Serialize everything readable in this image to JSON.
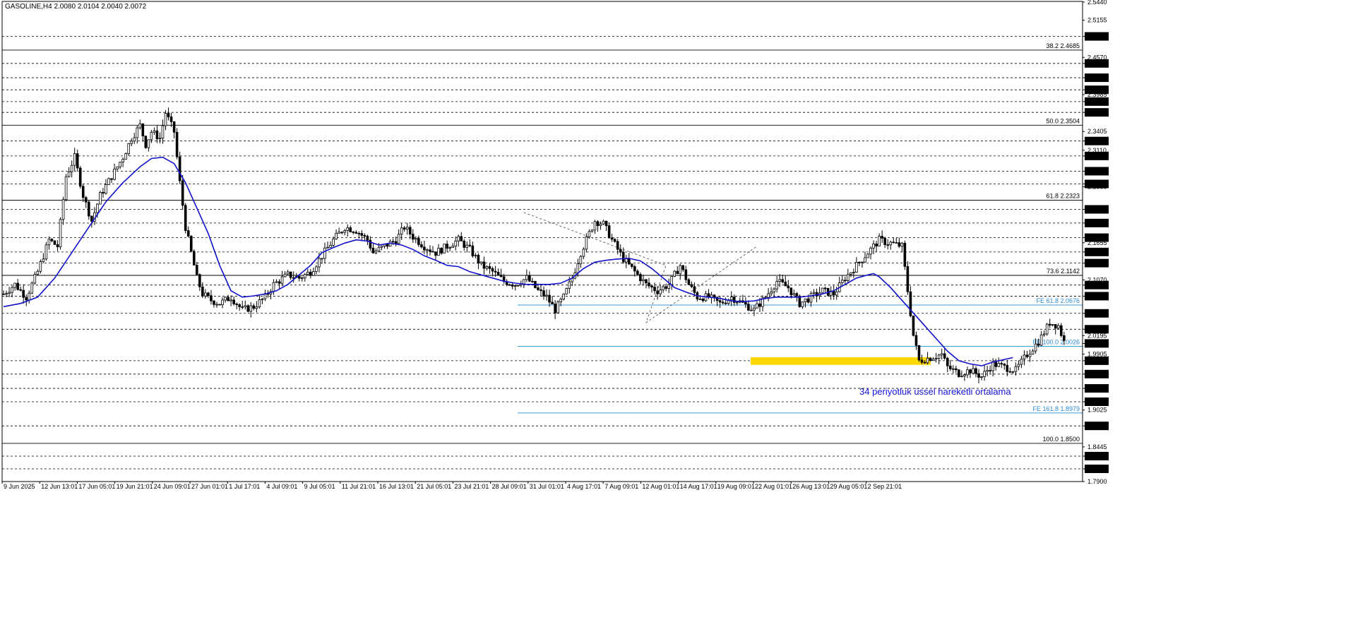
{
  "title": "GASOLINE,H4  2.0080 2.0104 2.0040 2.0072",
  "annotation": "34 periyotluk üssel hareketli ortalama",
  "colors": {
    "candles": "#000000",
    "ema": "#1212cc",
    "fe_lines": "#3d9ad8",
    "zone": "#ffd700",
    "grid": "#000000",
    "bg": "#ffffff",
    "current_price_bg": "#000000"
  },
  "chart_data": {
    "type": "candlestick",
    "symbol": "GASOLINE",
    "timeframe": "H4",
    "ohlc_last": {
      "open": 2.008,
      "high": 2.0104,
      "low": 2.004,
      "close": 2.0072
    },
    "ylim": [
      1.79,
      2.545
    ],
    "y_axis_labels": [
      "2.5440",
      "2.5155",
      "2.4900",
      "2.4570",
      "2.4475",
      "2.4250",
      "2.4060",
      "2.3985",
      "2.3875",
      "2.3705",
      "2.3405",
      "2.3255",
      "2.3110",
      "2.3020",
      "2.2780",
      "2.2580",
      "2.2535",
      "2.2180",
      "2.1965",
      "2.1735",
      "2.1655",
      "2.1510",
      "2.1335",
      "2.1070",
      "2.0990",
      "2.0815",
      "2.0545",
      "2.0295",
      "2.0195",
      "2.0072",
      "1.9905",
      "1.9800",
      "1.9590",
      "1.9365",
      "1.9155",
      "1.9025",
      "1.8775",
      "1.8445",
      "1.8300",
      "1.8100",
      "1.7900"
    ],
    "x_axis_labels": [
      "9 Jun 2025",
      "12 Jun 13:01",
      "17 Jun 05:01",
      "19 Jun 21:01",
      "24 Jun 09:01",
      "27 Jun 01:01",
      "1 Jul 17:01",
      "4 Jul 09:01",
      "9 Jul 05:01",
      "11 Jul 21:01",
      "16 Jul 13:01",
      "21 Jul 05:01",
      "23 Jul 21:01",
      "28 Jul 09:01",
      "31 Jul 01:01",
      "4 Aug 17:01",
      "7 Aug 09:01",
      "12 Aug 01:01",
      "14 Aug 17:01",
      "19 Aug 09:01",
      "22 Aug 01:01",
      "26 Aug 13:01",
      "29 Aug 05:01",
      "2 Sep 21:01"
    ],
    "fib_retracement": [
      {
        "label": "38.2 2.4685",
        "value": 2.4685
      },
      {
        "label": "50.0 2.3504",
        "value": 2.3504
      },
      {
        "label": "61.8 2.2323",
        "value": 2.2323
      },
      {
        "label": "73.6 2.1142",
        "value": 2.1142
      },
      {
        "label": "100.0 1.8500",
        "value": 1.85
      }
    ],
    "fib_expansion": [
      {
        "label": "FE 61.8 2.0676",
        "value": 2.0676
      },
      {
        "label": "FE 100.0 2.0026",
        "value": 2.0026
      },
      {
        "label": "FE 161.8 1.8979",
        "value": 1.8979
      }
    ],
    "horizontal_levels": [
      2.49,
      2.4475,
      2.425,
      2.406,
      2.3875,
      2.3705,
      2.3255,
      2.302,
      2.278,
      2.258,
      2.218,
      2.1965,
      2.1735,
      2.151,
      2.1335,
      2.099,
      2.0815,
      2.0545,
      2.0295,
      1.98,
      1.959,
      1.9365,
      1.9155,
      1.8775,
      1.83,
      1.81
    ],
    "support_zone": {
      "low": 1.9735,
      "high": 1.9855
    },
    "current_price": "2.0072",
    "series": [
      {
        "name": "34 periyotluk üssel hareketli ortalama",
        "type": "ema"
      }
    ],
    "swing_path": [
      [
        0,
        2.085
      ],
      [
        4,
        2.1
      ],
      [
        8,
        2.08
      ],
      [
        12,
        2.12
      ],
      [
        16,
        2.17
      ],
      [
        19,
        2.16
      ],
      [
        22,
        2.27
      ],
      [
        25,
        2.3
      ],
      [
        28,
        2.24
      ],
      [
        31,
        2.2
      ],
      [
        34,
        2.24
      ],
      [
        38,
        2.27
      ],
      [
        42,
        2.3
      ],
      [
        45,
        2.33
      ],
      [
        48,
        2.35
      ],
      [
        50,
        2.32
      ],
      [
        52,
        2.34
      ],
      [
        55,
        2.33
      ],
      [
        57,
        2.37
      ],
      [
        60,
        2.34
      ],
      [
        62,
        2.26
      ],
      [
        64,
        2.19
      ],
      [
        66,
        2.15
      ],
      [
        68,
        2.11
      ],
      [
        70,
        2.085
      ],
      [
        73,
        2.075
      ],
      [
        76,
        2.07
      ],
      [
        80,
        2.08
      ],
      [
        84,
        2.06
      ],
      [
        88,
        2.065
      ],
      [
        92,
        2.08
      ],
      [
        95,
        2.1
      ],
      [
        100,
        2.115
      ],
      [
        104,
        2.11
      ],
      [
        108,
        2.12
      ],
      [
        112,
        2.145
      ],
      [
        116,
        2.17
      ],
      [
        120,
        2.19
      ],
      [
        124,
        2.185
      ],
      [
        128,
        2.17
      ],
      [
        130,
        2.15
      ],
      [
        134,
        2.16
      ],
      [
        138,
        2.17
      ],
      [
        141,
        2.19
      ],
      [
        144,
        2.175
      ],
      [
        148,
        2.16
      ],
      [
        152,
        2.15
      ],
      [
        156,
        2.16
      ],
      [
        160,
        2.17
      ],
      [
        164,
        2.155
      ],
      [
        168,
        2.13
      ],
      [
        172,
        2.12
      ],
      [
        176,
        2.105
      ],
      [
        180,
        2.1
      ],
      [
        184,
        2.11
      ],
      [
        188,
        2.09
      ],
      [
        191,
        2.08
      ],
      [
        194,
        2.06
      ],
      [
        197,
        2.08
      ],
      [
        200,
        2.11
      ],
      [
        203,
        2.15
      ],
      [
        206,
        2.18
      ],
      [
        208,
        2.2
      ],
      [
        211,
        2.195
      ],
      [
        214,
        2.17
      ],
      [
        218,
        2.14
      ],
      [
        222,
        2.12
      ],
      [
        226,
        2.1
      ],
      [
        230,
        2.09
      ],
      [
        234,
        2.1
      ],
      [
        238,
        2.13
      ],
      [
        241,
        2.1
      ],
      [
        244,
        2.08
      ],
      [
        248,
        2.08
      ],
      [
        252,
        2.07
      ],
      [
        256,
        2.08
      ],
      [
        260,
        2.07
      ],
      [
        264,
        2.06
      ],
      [
        268,
        2.08
      ],
      [
        272,
        2.105
      ],
      [
        276,
        2.095
      ],
      [
        280,
        2.07
      ],
      [
        284,
        2.08
      ],
      [
        288,
        2.09
      ],
      [
        292,
        2.085
      ],
      [
        296,
        2.11
      ],
      [
        300,
        2.13
      ],
      [
        304,
        2.15
      ],
      [
        308,
        2.17
      ],
      [
        311,
        2.165
      ],
      [
        312,
        2.165
      ],
      [
        316,
        2.16
      ],
      [
        320,
        2.02
      ],
      [
        322,
        1.98
      ],
      [
        326,
        1.985
      ],
      [
        330,
        1.99
      ],
      [
        332,
        1.97
      ],
      [
        336,
        1.96
      ],
      [
        340,
        1.965
      ],
      [
        344,
        1.955
      ],
      [
        348,
        1.975
      ],
      [
        352,
        1.97
      ],
      [
        356,
        1.965
      ],
      [
        360,
        1.99
      ],
      [
        364,
        2.01
      ],
      [
        368,
        2.04
      ],
      [
        371,
        2.035
      ],
      [
        373,
        2.01
      ]
    ],
    "ema_path": [
      [
        0,
        2.065
      ],
      [
        6,
        2.07
      ],
      [
        12,
        2.08
      ],
      [
        18,
        2.11
      ],
      [
        24,
        2.15
      ],
      [
        30,
        2.19
      ],
      [
        36,
        2.23
      ],
      [
        42,
        2.26
      ],
      [
        48,
        2.285
      ],
      [
        52,
        2.298
      ],
      [
        56,
        2.3
      ],
      [
        60,
        2.29
      ],
      [
        64,
        2.26
      ],
      [
        68,
        2.22
      ],
      [
        72,
        2.18
      ],
      [
        76,
        2.13
      ],
      [
        80,
        2.09
      ],
      [
        84,
        2.08
      ],
      [
        88,
        2.082
      ],
      [
        92,
        2.085
      ],
      [
        96,
        2.09
      ],
      [
        100,
        2.1
      ],
      [
        104,
        2.115
      ],
      [
        108,
        2.13
      ],
      [
        112,
        2.15
      ],
      [
        116,
        2.158
      ],
      [
        120,
        2.165
      ],
      [
        124,
        2.17
      ],
      [
        128,
        2.168
      ],
      [
        132,
        2.162
      ],
      [
        136,
        2.165
      ],
      [
        140,
        2.162
      ],
      [
        144,
        2.155
      ],
      [
        148,
        2.145
      ],
      [
        152,
        2.138
      ],
      [
        156,
        2.13
      ],
      [
        160,
        2.128
      ],
      [
        164,
        2.12
      ],
      [
        168,
        2.115
      ],
      [
        172,
        2.11
      ],
      [
        176,
        2.105
      ],
      [
        180,
        2.102
      ],
      [
        184,
        2.1
      ],
      [
        188,
        2.1
      ],
      [
        192,
        2.1
      ],
      [
        196,
        2.102
      ],
      [
        200,
        2.11
      ],
      [
        204,
        2.125
      ],
      [
        208,
        2.135
      ],
      [
        212,
        2.138
      ],
      [
        216,
        2.14
      ],
      [
        220,
        2.141
      ],
      [
        224,
        2.137
      ],
      [
        228,
        2.125
      ],
      [
        232,
        2.11
      ],
      [
        236,
        2.095
      ],
      [
        240,
        2.088
      ],
      [
        244,
        2.082
      ],
      [
        248,
        2.08
      ],
      [
        252,
        2.078
      ],
      [
        256,
        2.074
      ],
      [
        260,
        2.073
      ],
      [
        264,
        2.074
      ],
      [
        268,
        2.078
      ],
      [
        272,
        2.08
      ],
      [
        276,
        2.08
      ],
      [
        280,
        2.08
      ],
      [
        284,
        2.082
      ],
      [
        288,
        2.085
      ],
      [
        292,
        2.09
      ],
      [
        296,
        2.1
      ],
      [
        300,
        2.11
      ],
      [
        304,
        2.115
      ],
      [
        306,
        2.117
      ],
      [
        308,
        2.112
      ],
      [
        312,
        2.095
      ],
      [
        316,
        2.075
      ],
      [
        320,
        2.055
      ],
      [
        324,
        2.035
      ],
      [
        328,
        2.015
      ],
      [
        332,
        1.995
      ],
      [
        336,
        1.98
      ],
      [
        340,
        1.975
      ],
      [
        344,
        1.972
      ],
      [
        348,
        1.978
      ],
      [
        352,
        1.982
      ],
      [
        355,
        1.985
      ]
    ],
    "dashed_swings": [
      [
        [
          183,
          2.213
        ],
        [
          233,
          2.13
        ],
        [
          226,
          2.04
        ],
        [
          265,
          2.16
        ]
      ]
    ]
  }
}
